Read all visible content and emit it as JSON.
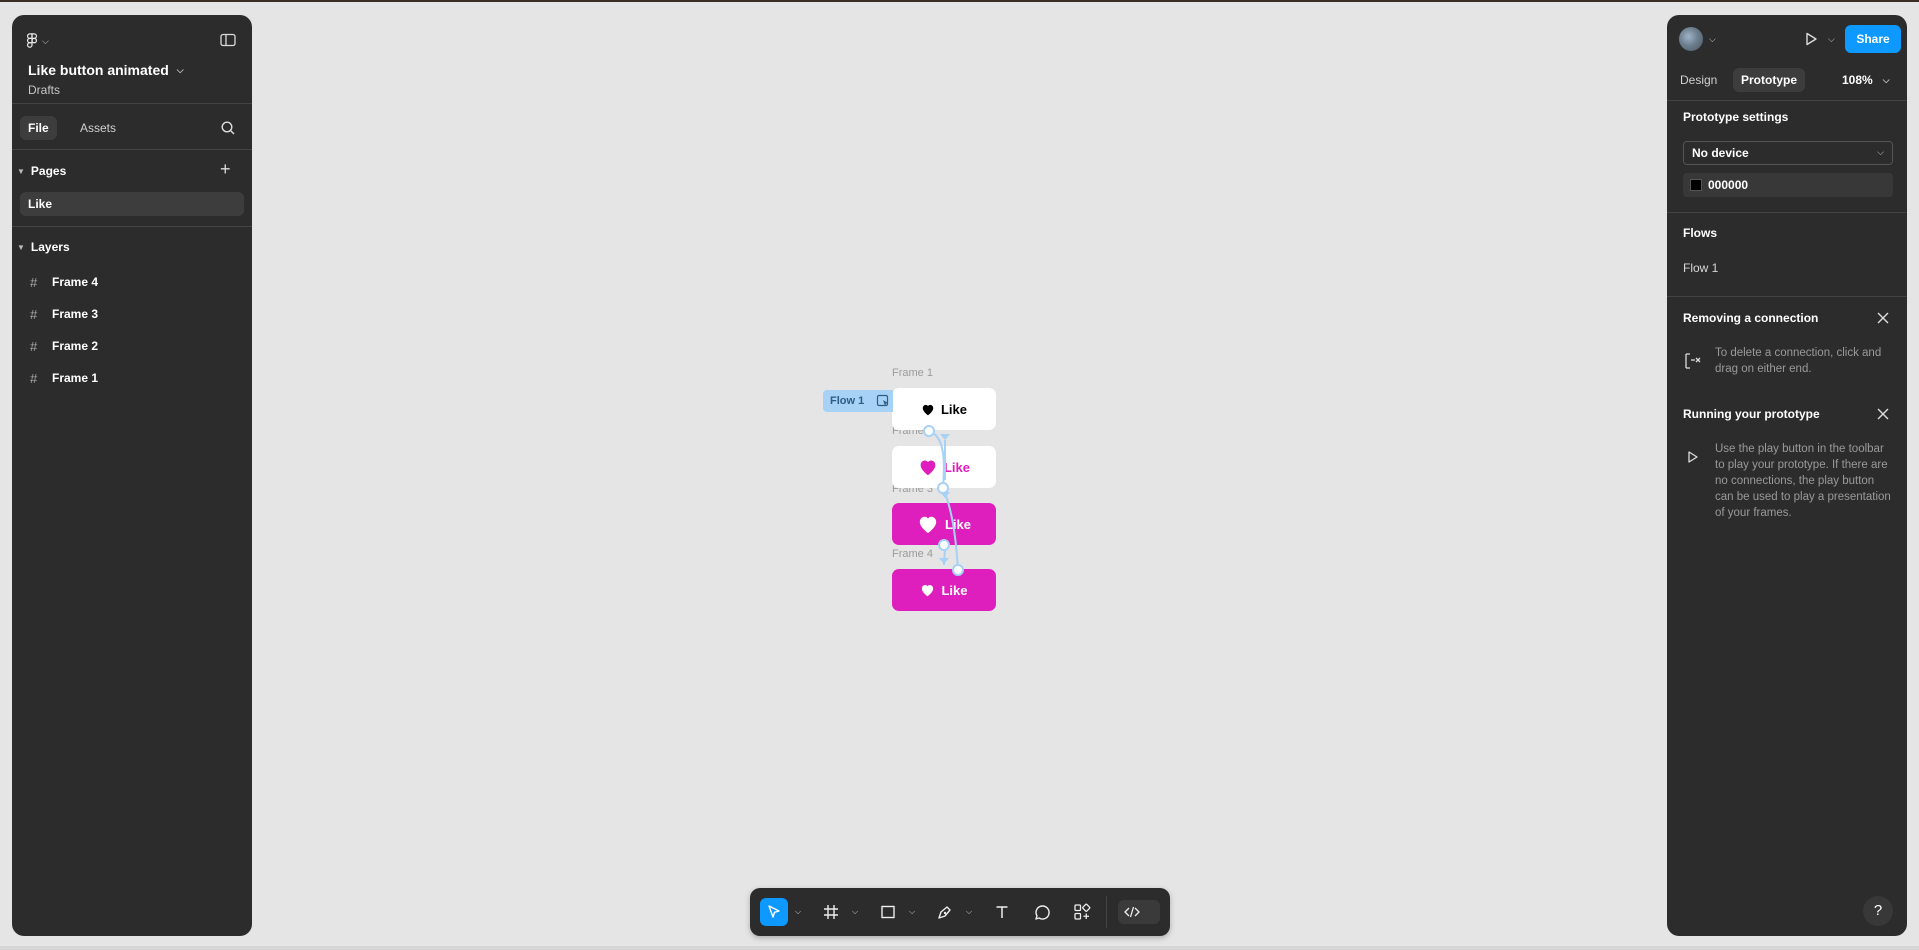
{
  "file": {
    "name": "Like button animated",
    "location": "Drafts"
  },
  "left_tabs": {
    "file": "File",
    "assets": "Assets"
  },
  "pages": {
    "heading": "Pages",
    "items": [
      "Like"
    ]
  },
  "layers": {
    "heading": "Layers",
    "items": [
      "Frame 4",
      "Frame 3",
      "Frame 2",
      "Frame 1"
    ]
  },
  "right": {
    "share_label": "Share",
    "tabs": {
      "design": "Design",
      "prototype": "Prototype"
    },
    "zoom": "108%",
    "prototype_settings": {
      "heading": "Prototype settings",
      "device": "No device",
      "background_hex": "000000"
    },
    "flows": {
      "heading": "Flows",
      "items": [
        "Flow 1"
      ]
    },
    "tips": [
      {
        "title": "Removing a connection",
        "text": "To delete a connection, click and drag on either end."
      },
      {
        "title": "Running your prototype",
        "text": "Use the play button in the toolbar to play your prototype. If there are no connections, the play button can be used to play a presentation of your frames."
      }
    ],
    "help_label": "?"
  },
  "canvas": {
    "flow_tag": "Flow 1",
    "frames": [
      {
        "label": "Frame 1",
        "button_text": "Like",
        "style": "white",
        "heart_color": "#000000"
      },
      {
        "label": "Frame 2",
        "button_text": "Like",
        "style": "white",
        "heart_color": "#de1fbd"
      },
      {
        "label": "Frame 3",
        "button_text": "Like",
        "style": "pink",
        "heart_color": "#ffffff"
      },
      {
        "label": "Frame 4",
        "button_text": "Like",
        "style": "pink",
        "heart_color": "#ffffff"
      }
    ]
  },
  "colors": {
    "accent": "#0d99ff",
    "like_pink": "#de1fbd",
    "panel": "#2c2c2c",
    "canvas": "#e5e5e5",
    "connector": "#a7d1f5"
  },
  "toolbar": {
    "tools": [
      "move-tool",
      "frame-tool",
      "rectangle-tool",
      "pen-tool",
      "text-tool",
      "comment-tool",
      "actions-tool",
      "dev-mode-toggle"
    ]
  }
}
